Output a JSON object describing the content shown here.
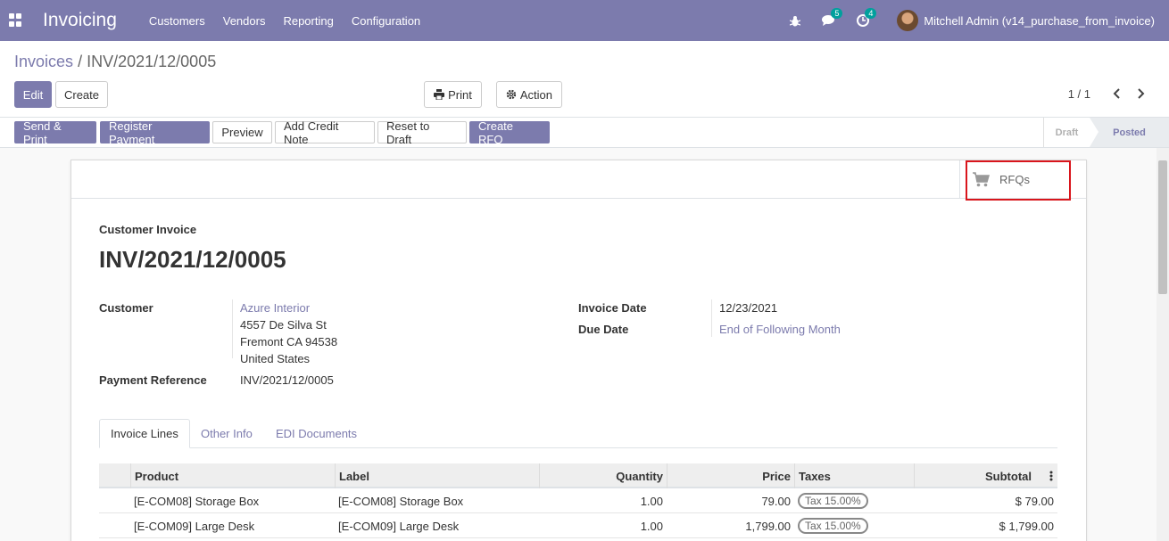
{
  "navbar": {
    "app_title": "Invoicing",
    "menu": [
      "Customers",
      "Vendors",
      "Reporting",
      "Configuration"
    ],
    "messages_count": "5",
    "activities_count": "4",
    "user_name": "Mitchell Admin (v14_purchase_from_invoice)",
    "bg_color": "#7c7bad"
  },
  "breadcrumb": {
    "parent": "Invoices",
    "separator": "/",
    "current": "INV/2021/12/0005"
  },
  "control": {
    "edit_label": "Edit",
    "create_label": "Create",
    "print_label": "Print",
    "action_label": "Action",
    "pager": "1 / 1"
  },
  "statusbar": {
    "buttons": [
      "Send & Print",
      "Register Payment",
      "Preview",
      "Add Credit Note",
      "Reset to Draft",
      "Create RFQ"
    ],
    "stages": [
      "Draft",
      "Posted"
    ],
    "current_stage": "Posted"
  },
  "smart_button": {
    "label": "RFQs",
    "icon": "shopping-cart-icon"
  },
  "invoice": {
    "type": "Customer Invoice",
    "name": "INV/2021/12/0005",
    "customer_label": "Customer",
    "customer_name": "Azure Interior",
    "address": [
      "4557 De Silva St",
      "Fremont CA 94538",
      "United States"
    ],
    "payment_ref_label": "Payment Reference",
    "payment_ref": "INV/2021/12/0005",
    "invoice_date_label": "Invoice Date",
    "invoice_date": "12/23/2021",
    "due_date_label": "Due Date",
    "due_date": "End of Following Month"
  },
  "tabs": [
    "Invoice Lines",
    "Other Info",
    "EDI Documents"
  ],
  "lines": {
    "headers": [
      "Product",
      "Label",
      "Quantity",
      "Price",
      "Taxes",
      "Subtotal"
    ],
    "rows": [
      {
        "product": "[E-COM08] Storage Box",
        "label": "[E-COM08] Storage Box",
        "quantity": "1.00",
        "price": "79.00",
        "tax": "Tax 15.00%",
        "subtotal": "$ 79.00"
      },
      {
        "product": "[E-COM09] Large Desk",
        "label": "[E-COM09] Large Desk",
        "quantity": "1.00",
        "price": "1,799.00",
        "tax": "Tax 15.00%",
        "subtotal": "$ 1,799.00"
      }
    ]
  }
}
